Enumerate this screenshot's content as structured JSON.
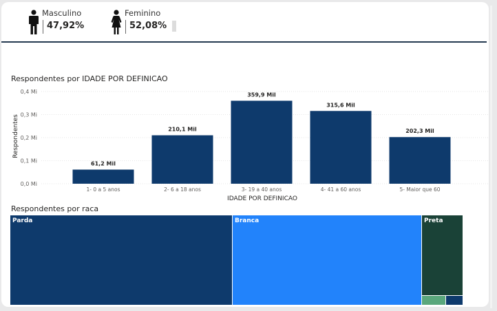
{
  "gender": {
    "male": {
      "label": "Masculino",
      "value": "47,92%"
    },
    "female": {
      "label": "Feminino",
      "value": "52,08%"
    }
  },
  "colors": {
    "bar": "#0e3a6c",
    "grid": "#e6e6e6",
    "parda": "#0e3a6c",
    "branca": "#2283fb",
    "preta": "#1a4237",
    "small1": "#5aa77c",
    "small2": "#0e3a6c"
  },
  "chart_data": [
    {
      "type": "bar",
      "title": "Respondentes por IDADE POR DEFINICAO",
      "xlabel": "IDADE POR DEFINICAO",
      "ylabel": "Respondentes",
      "ylim": [
        0,
        0.4
      ],
      "yticks": [
        "0,0 Mi",
        "0,1 Mi",
        "0,2 Mi",
        "0,3 Mi",
        "0,4 Mi"
      ],
      "grid": true,
      "categories": [
        "1- 0 a 5 anos",
        "2- 6 a 18 anos",
        "3- 19 a 40 anos",
        "4- 41 a 60 anos",
        "5- Maior que 60"
      ],
      "values": [
        61.2,
        210.1,
        359.9,
        315.6,
        202.3
      ],
      "data_labels": [
        "61,2 Mil",
        "210,1 Mil",
        "359,9 Mil",
        "315,6 Mil",
        "202,3 Mil"
      ]
    },
    {
      "type": "treemap",
      "title": "Respondentes por raca",
      "categories": [
        "Parda",
        "Branca",
        "Preta"
      ]
    }
  ]
}
